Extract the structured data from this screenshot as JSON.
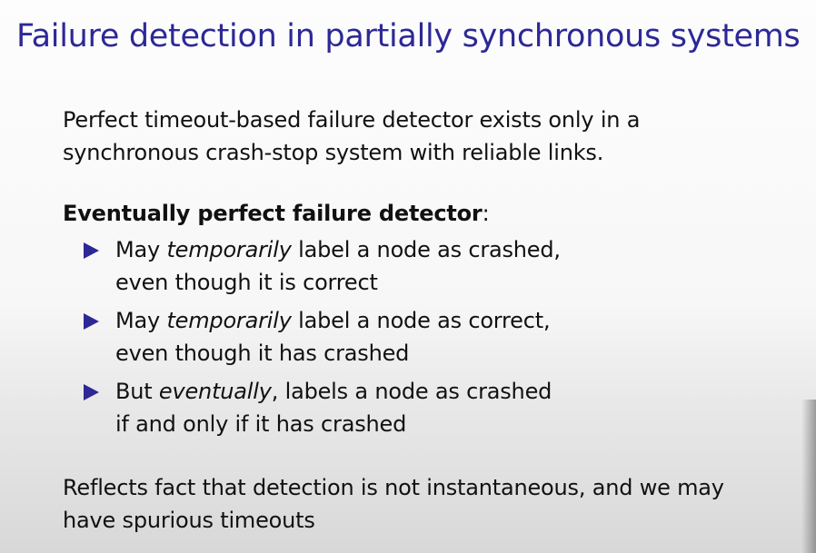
{
  "slide": {
    "title": "Failure detection in partially synchronous systems",
    "intro": {
      "line1": "Perfect timeout-based failure detector exists only in a",
      "line2": "synchronous crash-stop system with reliable links."
    },
    "section": {
      "heading_bold": "Eventually perfect failure detector",
      "heading_suffix": ":"
    },
    "bullets": [
      {
        "pre": "May ",
        "emph": "temporarily",
        "post": " label a node as crashed,",
        "line2": "even though it is correct"
      },
      {
        "pre": "May ",
        "emph": "temporarily",
        "post": " label a node as correct,",
        "line2": "even though it has crashed"
      },
      {
        "pre": "But ",
        "emph": "eventually",
        "post": ", labels a node as crashed",
        "line2": "if and only if it has crashed"
      }
    ],
    "conclusion": {
      "line1": "Reflects fact that detection is not instantaneous, and we may",
      "line2": "have spurious timeouts"
    },
    "colors": {
      "title": "#2d2896",
      "bullet_marker": "#2d2896",
      "text": "#111111"
    },
    "icons": {
      "bullet_marker": "right-triangle-icon"
    }
  }
}
